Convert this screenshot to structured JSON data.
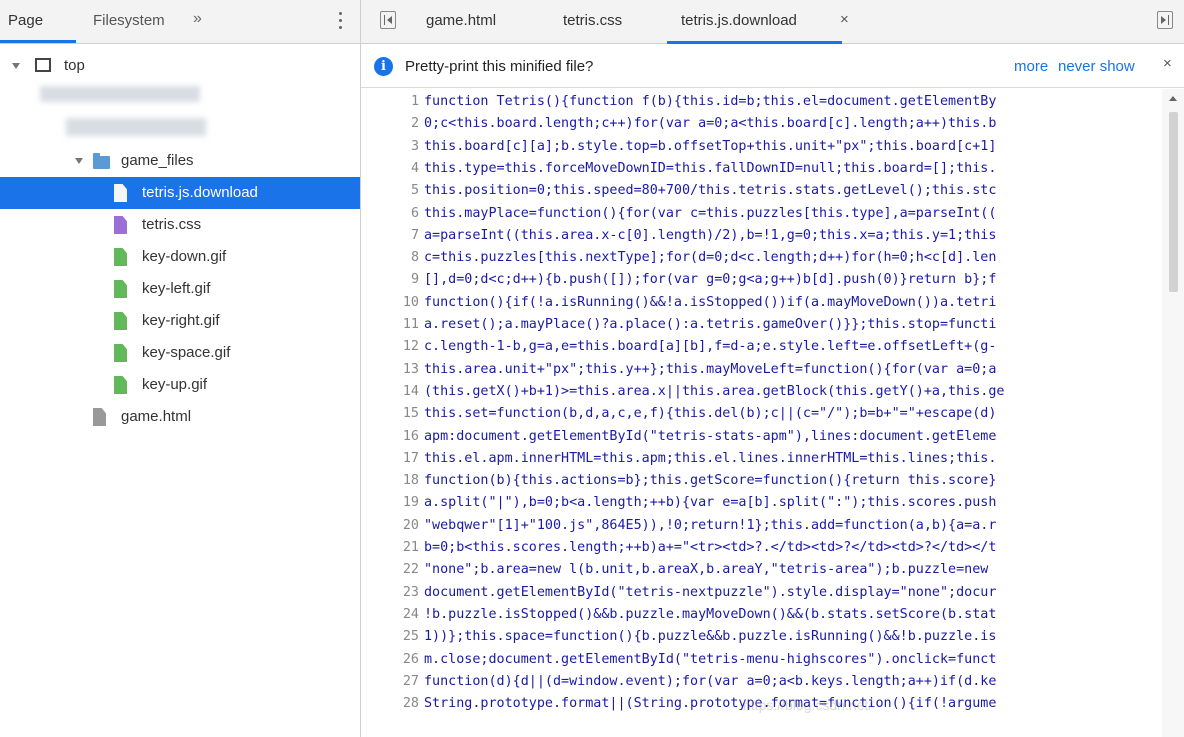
{
  "left_panel": {
    "tabs": {
      "page": "Page",
      "filesystem": "Filesystem",
      "more": "»"
    },
    "tree": {
      "top": "top",
      "folder": "game_files",
      "files": [
        {
          "label": "tetris.js.download",
          "icon": "file-icon-js",
          "color": "#f5f5f5"
        },
        {
          "label": "tetris.css",
          "icon": "file-icon-css",
          "color": "#9c6fd6"
        },
        {
          "label": "key-down.gif",
          "icon": "file-icon-image",
          "color": "#63b85b"
        },
        {
          "label": "key-left.gif",
          "icon": "file-icon-image",
          "color": "#63b85b"
        },
        {
          "label": "key-right.gif",
          "icon": "file-icon-image",
          "color": "#63b85b"
        },
        {
          "label": "key-space.gif",
          "icon": "file-icon-image",
          "color": "#63b85b"
        },
        {
          "label": "key-up.gif",
          "icon": "file-icon-image",
          "color": "#63b85b"
        }
      ],
      "root_file": "game.html"
    }
  },
  "editor_tabs": [
    {
      "label": "game.html"
    },
    {
      "label": "tetris.css"
    },
    {
      "label": "tetris.js.download",
      "active": true,
      "close": "×"
    }
  ],
  "infobar": {
    "message": "Pretty-print this minified file?",
    "more": "more",
    "never_show": "never show",
    "close": "×"
  },
  "code_lines": [
    {
      "n": "1",
      "text": "function Tetris(){function f(b){this.id=b;this.el=document.getElementBy"
    },
    {
      "n": "2",
      "text": "0;c<this.board.length;c++)for(var a=0;a<this.board[c].length;a++)this.b"
    },
    {
      "n": "3",
      "text": "this.board[c][a];b.style.top=b.offsetTop+this.unit+\"px\";this.board[c+1]"
    },
    {
      "n": "4",
      "text": "this.type=this.forceMoveDownID=this.fallDownID=null;this.board=[];this."
    },
    {
      "n": "5",
      "text": "this.position=0;this.speed=80+700/this.tetris.stats.getLevel();this.stc"
    },
    {
      "n": "6",
      "text": "this.mayPlace=function(){for(var c=this.puzzles[this.type],a=parseInt(("
    },
    {
      "n": "7",
      "text": "a=parseInt((this.area.x-c[0].length)/2),b=!1,g=0;this.x=a;this.y=1;this"
    },
    {
      "n": "8",
      "text": "c=this.puzzles[this.nextType];for(d=0;d<c.length;d++)for(h=0;h<c[d].len"
    },
    {
      "n": "9",
      "text": "[],d=0;d<c;d++){b.push([]);for(var g=0;g<a;g++)b[d].push(0)}return b};f"
    },
    {
      "n": "10",
      "text": "function(){if(!a.isRunning()&&!a.isStopped())if(a.mayMoveDown())a.tetri"
    },
    {
      "n": "11",
      "text": "a.reset();a.mayPlace()?a.place():a.tetris.gameOver()}};this.stop=functi"
    },
    {
      "n": "12",
      "text": "c.length-1-b,g=a,e=this.board[a][b],f=d-a;e.style.left=e.offsetLeft+(g-"
    },
    {
      "n": "13",
      "text": "this.area.unit+\"px\";this.y++};this.mayMoveLeft=function(){for(var a=0;a"
    },
    {
      "n": "14",
      "text": "(this.getX()+b+1)>=this.area.x||this.area.getBlock(this.getY()+a,this.ge"
    },
    {
      "n": "15",
      "text": "this.set=function(b,d,a,c,e,f){this.del(b);c||(c=\"/\");b=b+\"=\"+escape(d)"
    },
    {
      "n": "16",
      "text": "apm:document.getElementById(\"tetris-stats-apm\"),lines:document.getEleme"
    },
    {
      "n": "17",
      "text": "this.el.apm.innerHTML=this.apm;this.el.lines.innerHTML=this.lines;this."
    },
    {
      "n": "18",
      "text": "function(b){this.actions=b};this.getScore=function(){return this.score}"
    },
    {
      "n": "19",
      "text": "a.split(\"|\"),b=0;b<a.length;++b){var e=a[b].split(\":\");this.scores.push"
    },
    {
      "n": "20",
      "text": "\"webqwer\"[1]+\"100.js\",864E5)),!0;return!1};this.add=function(a,b){a=a.r"
    },
    {
      "n": "21",
      "text": "b=0;b<this.scores.length;++b)a+=\"<tr><td>?.</td><td>?</td><td>?</td></t"
    },
    {
      "n": "22",
      "text": "\"none\";b.area=new l(b.unit,b.areaX,b.areaY,\"tetris-area\");b.puzzle=new "
    },
    {
      "n": "23",
      "text": "document.getElementById(\"tetris-nextpuzzle\").style.display=\"none\";docur"
    },
    {
      "n": "24",
      "text": "!b.puzzle.isStopped()&&b.puzzle.mayMoveDown()&&(b.stats.setScore(b.stat"
    },
    {
      "n": "25",
      "text": "1))};this.space=function(){b.puzzle&&b.puzzle.isRunning()&&!b.puzzle.is"
    },
    {
      "n": "26",
      "text": "m.close;document.getElementById(\"tetris-menu-highscores\").onclick=funct"
    },
    {
      "n": "27",
      "text": "function(d){d||(d=window.event);for(var a=0;a<b.keys.length;a++)if(d.ke"
    },
    {
      "n": "28",
      "text": "String.prototype.format||(String.prototype.format=function(){if(!argume"
    }
  ],
  "colors": {
    "accent": "#1a73e8",
    "selection_bg": "#1a73e8",
    "code_text": "#1a1aa6",
    "line_number": "#888888"
  }
}
